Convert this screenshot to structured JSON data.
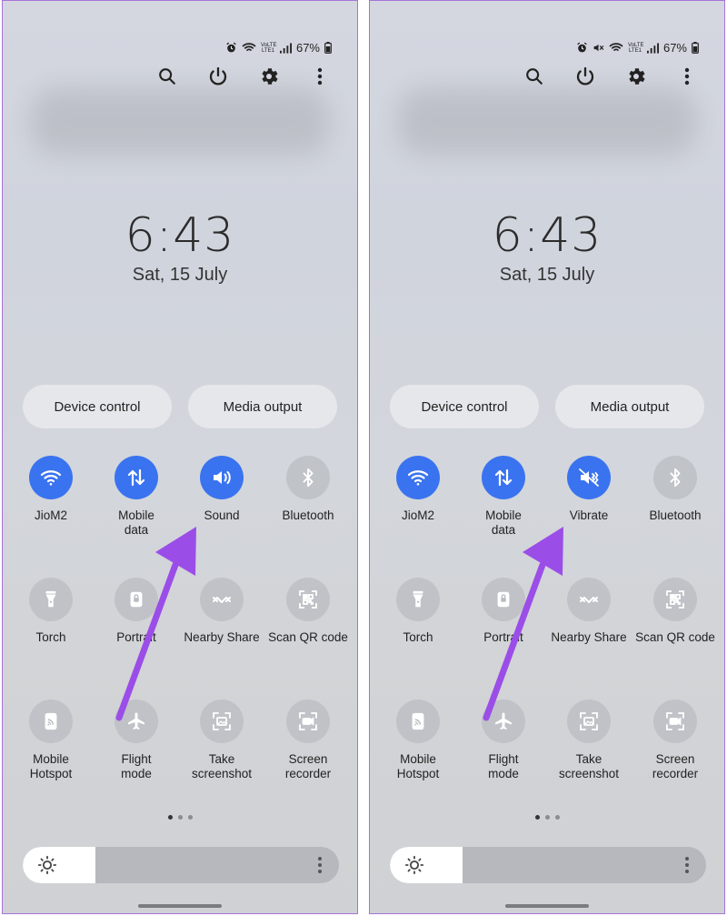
{
  "screens": [
    {
      "status": {
        "battery": "67%",
        "network": "VoLTE LTE1"
      },
      "clock": "6:43",
      "date": "Sat, 15 July",
      "pills": [
        "Device control",
        "Media output"
      ],
      "tiles": [
        {
          "label": "JioM2",
          "icon": "wifi-icon",
          "on": true
        },
        {
          "label": "Mobile\ndata",
          "icon": "mobile-data-icon",
          "on": true
        },
        {
          "label": "Sound",
          "icon": "sound-icon",
          "on": true
        },
        {
          "label": "Bluetooth",
          "icon": "bluetooth-icon",
          "on": false
        },
        {
          "label": "Torch",
          "icon": "torch-icon",
          "on": false
        },
        {
          "label": "Portrait",
          "icon": "portrait-icon",
          "on": false
        },
        {
          "label": "Nearby Share",
          "icon": "nearby-share-icon",
          "on": false
        },
        {
          "label": "Scan QR code",
          "icon": "qr-icon",
          "on": false
        },
        {
          "label": "Mobile\nHotspot",
          "icon": "hotspot-icon",
          "on": false
        },
        {
          "label": "Flight\nmode",
          "icon": "airplane-icon",
          "on": false
        },
        {
          "label": "Take\nscreenshot",
          "icon": "screenshot-icon",
          "on": false
        },
        {
          "label": "Screen\nrecorder",
          "icon": "screen-recorder-icon",
          "on": false
        }
      ]
    },
    {
      "status": {
        "battery": "67%",
        "network": "VoLTE LTE1"
      },
      "clock": "6:43",
      "date": "Sat, 15 July",
      "pills": [
        "Device control",
        "Media output"
      ],
      "tiles": [
        {
          "label": "JioM2",
          "icon": "wifi-icon",
          "on": true
        },
        {
          "label": "Mobile\ndata",
          "icon": "mobile-data-icon",
          "on": true
        },
        {
          "label": "Vibrate",
          "icon": "vibrate-icon",
          "on": true
        },
        {
          "label": "Bluetooth",
          "icon": "bluetooth-icon",
          "on": false
        },
        {
          "label": "Torch",
          "icon": "torch-icon",
          "on": false
        },
        {
          "label": "Portrait",
          "icon": "portrait-icon",
          "on": false
        },
        {
          "label": "Nearby Share",
          "icon": "nearby-share-icon",
          "on": false
        },
        {
          "label": "Scan QR code",
          "icon": "qr-icon",
          "on": false
        },
        {
          "label": "Mobile\nHotspot",
          "icon": "hotspot-icon",
          "on": false
        },
        {
          "label": "Flight\nmode",
          "icon": "airplane-icon",
          "on": false
        },
        {
          "label": "Take\nscreenshot",
          "icon": "screenshot-icon",
          "on": false
        },
        {
          "label": "Screen\nrecorder",
          "icon": "screen-recorder-icon",
          "on": false
        }
      ]
    }
  ],
  "colors": {
    "accent": "#3a73f0",
    "annotation_arrow": "#9b4de8"
  }
}
